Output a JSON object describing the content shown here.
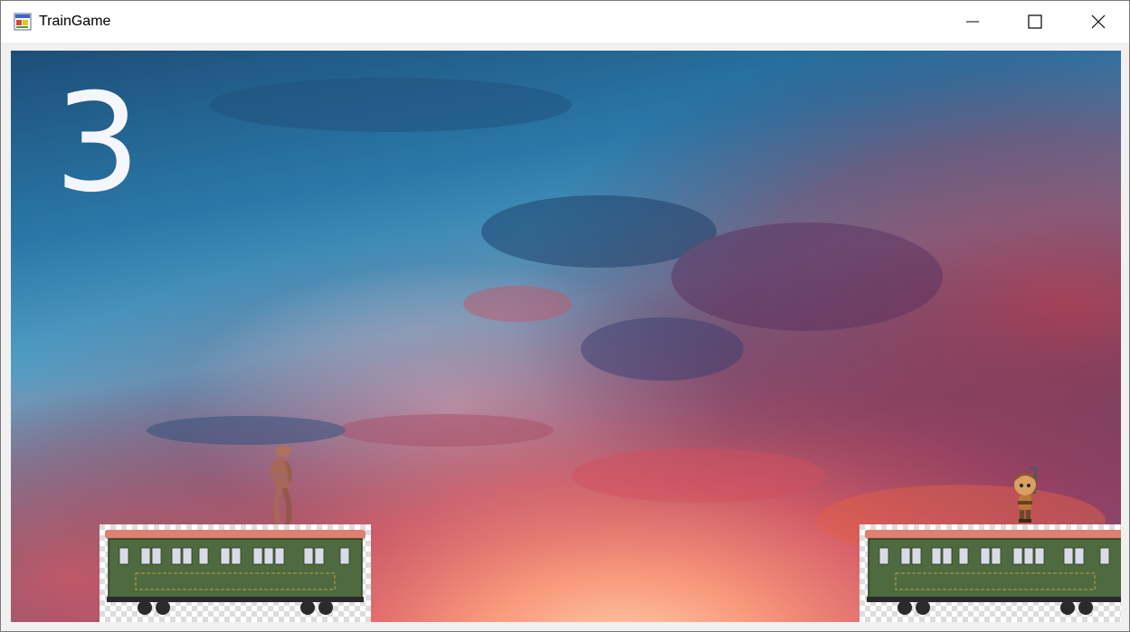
{
  "window": {
    "title": "TrainGame",
    "controls": [
      "minimize",
      "maximize",
      "close"
    ]
  },
  "game": {
    "countdown": "3",
    "colors": {
      "train_body": "#4e6a3e",
      "train_roof": "#e08070",
      "countdown_text": "#f4f6fb"
    },
    "entities": {
      "left_character": "mannequin-figure",
      "right_character": "cartoon-hero-figure",
      "trains": [
        "left-train-car",
        "right-train-car"
      ]
    }
  }
}
